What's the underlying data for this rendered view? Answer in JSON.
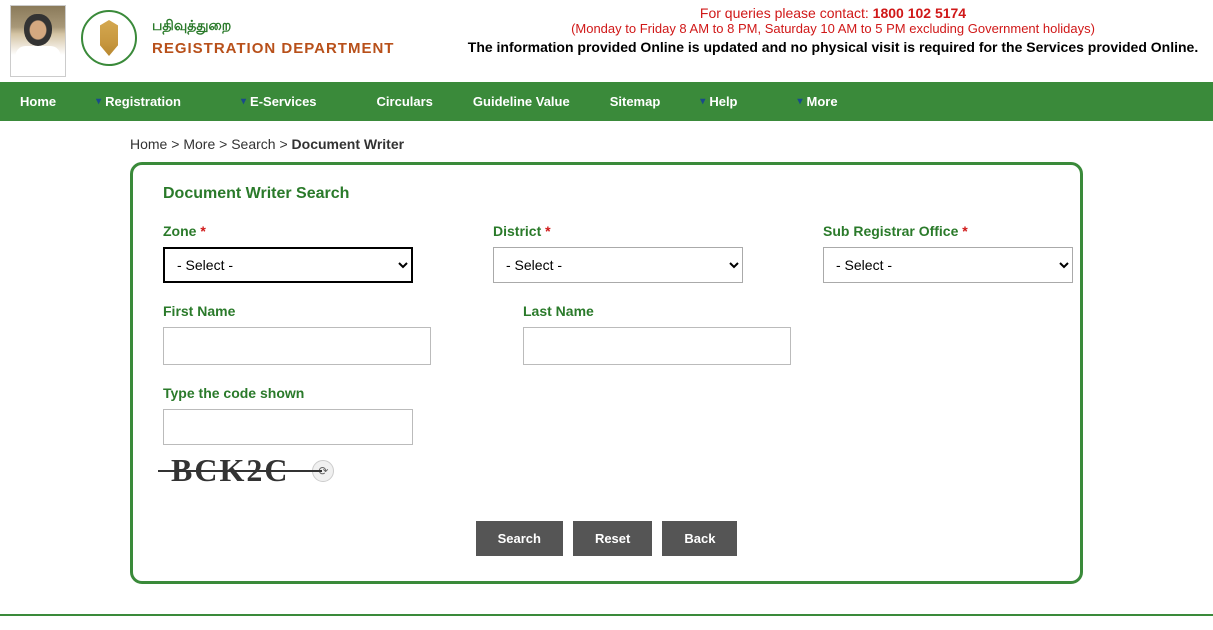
{
  "header": {
    "tamil_dept": "பதிவுத்துறை",
    "eng_dept": "REGISTRATION DEPARTMENT",
    "query_prefix": "For queries please contact: ",
    "phone": "1800 102 5174",
    "timing": "(Monday to Friday 8 AM to 8 PM, Saturday 10 AM to 5 PM excluding Government holidays)",
    "info": "The information provided Online is updated and no physical visit is required for the Services provided Online."
  },
  "nav": {
    "home": "Home",
    "registration": "Registration",
    "eservices": "E-Services",
    "circulars": "Circulars",
    "guideline": "Guideline Value",
    "sitemap": "Sitemap",
    "help": "Help",
    "more": "More"
  },
  "breadcrumb": {
    "home": "Home",
    "more": "More",
    "search": "Search",
    "current": "Document Writer"
  },
  "form": {
    "title": "Document Writer Search",
    "zone_label": "Zone ",
    "district_label": "District ",
    "sro_label": "Sub Registrar Office ",
    "fname_label": "First Name",
    "lname_label": "Last Name",
    "captcha_label": "Type the code shown",
    "select_placeholder": "- Select -",
    "captcha_text": "BCK2C"
  },
  "buttons": {
    "search": "Search",
    "reset": "Reset",
    "back": "Back"
  }
}
